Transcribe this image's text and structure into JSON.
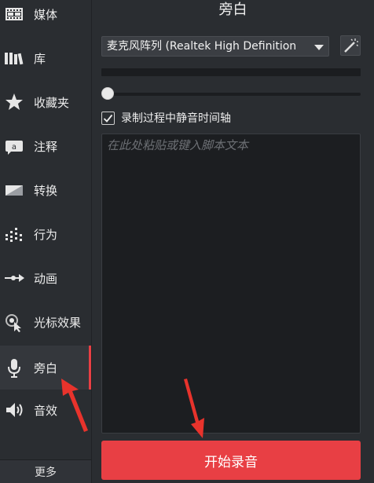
{
  "sidebar": {
    "items": [
      {
        "label": "媒体",
        "icon": "film-icon"
      },
      {
        "label": "库",
        "icon": "library-icon"
      },
      {
        "label": "收藏夹",
        "icon": "star-icon"
      },
      {
        "label": "注释",
        "icon": "annotation-icon"
      },
      {
        "label": "转换",
        "icon": "transition-icon"
      },
      {
        "label": "行为",
        "icon": "behavior-icon"
      },
      {
        "label": "动画",
        "icon": "animation-icon"
      },
      {
        "label": "光标效果",
        "icon": "cursor-effect-icon"
      },
      {
        "label": "旁白",
        "icon": "microphone-icon",
        "active": true
      },
      {
        "label": "音效",
        "icon": "speaker-icon"
      }
    ],
    "more_label": "更多"
  },
  "panel": {
    "title": "旁白",
    "mic_device": "麦克风阵列 (Realtek High Definition",
    "mute_label": "录制过程中静音时间轴",
    "mute_checked": true,
    "volume_level": 0,
    "script_placeholder": "在此处粘贴或键入脚本文本",
    "record_label": "开始录音"
  },
  "colors": {
    "accent": "#e83f44",
    "background": "#2a2d31",
    "annotation_arrow": "#e8332c"
  }
}
